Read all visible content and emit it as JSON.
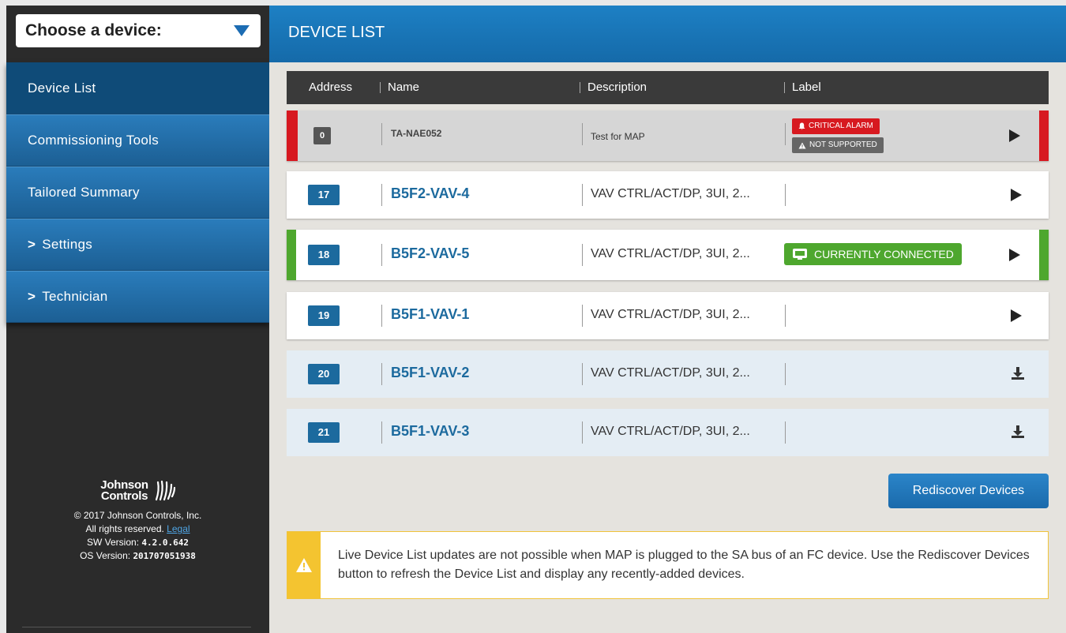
{
  "sidebar": {
    "device_select_label": "Choose a device:",
    "nav": [
      {
        "label": "Device List",
        "active": true
      },
      {
        "label": "Commissioning Tools"
      },
      {
        "label": "Tailored Summary"
      },
      {
        "label": "Settings",
        "chevron": ">"
      },
      {
        "label": "Technician",
        "chevron": ">"
      }
    ],
    "footer": {
      "logo_line1": "Johnson",
      "logo_line2": "Controls",
      "copyright": "© 2017 Johnson Controls, Inc.",
      "rights": "All rights reserved.",
      "legal_link": "Legal",
      "sw_label": "SW Version:",
      "sw_value": "4.2.0.642",
      "os_label": "OS Version:",
      "os_value": "201707051938"
    }
  },
  "main": {
    "title": "DEVICE LIST",
    "columns": [
      "Address",
      "Name",
      "Description",
      "Label"
    ],
    "rows": [
      {
        "address": "0",
        "name": "TA-NAE052",
        "description": "Test for MAP",
        "badges": [
          "CRITICAL ALARM",
          "NOT SUPPORTED"
        ],
        "action": "play"
      },
      {
        "address": "17",
        "name": "B5F2-VAV-4",
        "description": "VAV CTRL/ACT/DP, 3UI, 2...",
        "action": "play"
      },
      {
        "address": "18",
        "name": "B5F2-VAV-5",
        "description": "VAV CTRL/ACT/DP, 3UI, 2...",
        "badge_connected": "CURRENTLY CONNECTED",
        "action": "play"
      },
      {
        "address": "19",
        "name": "B5F1-VAV-1",
        "description": "VAV CTRL/ACT/DP, 3UI, 2...",
        "action": "play"
      },
      {
        "address": "20",
        "name": "B5F1-VAV-2",
        "description": "VAV CTRL/ACT/DP, 3UI, 2...",
        "action": "download"
      },
      {
        "address": "21",
        "name": "B5F1-VAV-3",
        "description": "VAV CTRL/ACT/DP, 3UI, 2...",
        "action": "download"
      }
    ],
    "rediscover_label": "Rediscover Devices",
    "notice": "Live Device List updates are not possible when MAP is plugged to the SA bus of an FC device. Use the Rediscover Devices button to refresh the Device List and display any recently-added devices.",
    "colors": {
      "accent": "#1c6a9e",
      "alarm": "#d71920",
      "connected": "#4ea72e",
      "warning": "#f4c430"
    },
    "icons": [
      "chevron-down-icon",
      "bell-icon",
      "warning-icon",
      "monitor-icon",
      "play-icon",
      "download-icon"
    ]
  }
}
